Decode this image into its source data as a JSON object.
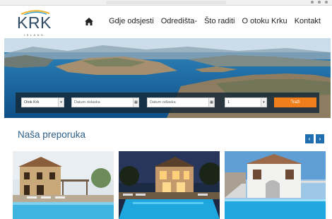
{
  "brand": {
    "name": "KRK",
    "tagline": "ISLAND"
  },
  "nav": {
    "home_icon": "home-icon",
    "items": [
      "Gdje odsjesti",
      "Odredišta",
      "Što raditi",
      "O otoku Krku",
      "Kontakt"
    ]
  },
  "search": {
    "location_value": "Otok Krk",
    "date_from_placeholder": "Datum dolaska",
    "date_to_placeholder": "Datum odlaska",
    "guests_value": "1",
    "button_label": "Traži"
  },
  "recommendations": {
    "title": "Naša preporuka",
    "prev_label": "‹",
    "next_label": "›",
    "cards": [
      {
        "name": "stone-house-with-pool"
      },
      {
        "name": "villa-at-dusk-with-pool"
      },
      {
        "name": "white-house-with-pool"
      }
    ]
  },
  "colors": {
    "brand_blue": "#2f4a63",
    "title_blue": "#2e5f86",
    "accent_orange": "#f07e1b",
    "arrow_blue": "#1f6fb0"
  }
}
